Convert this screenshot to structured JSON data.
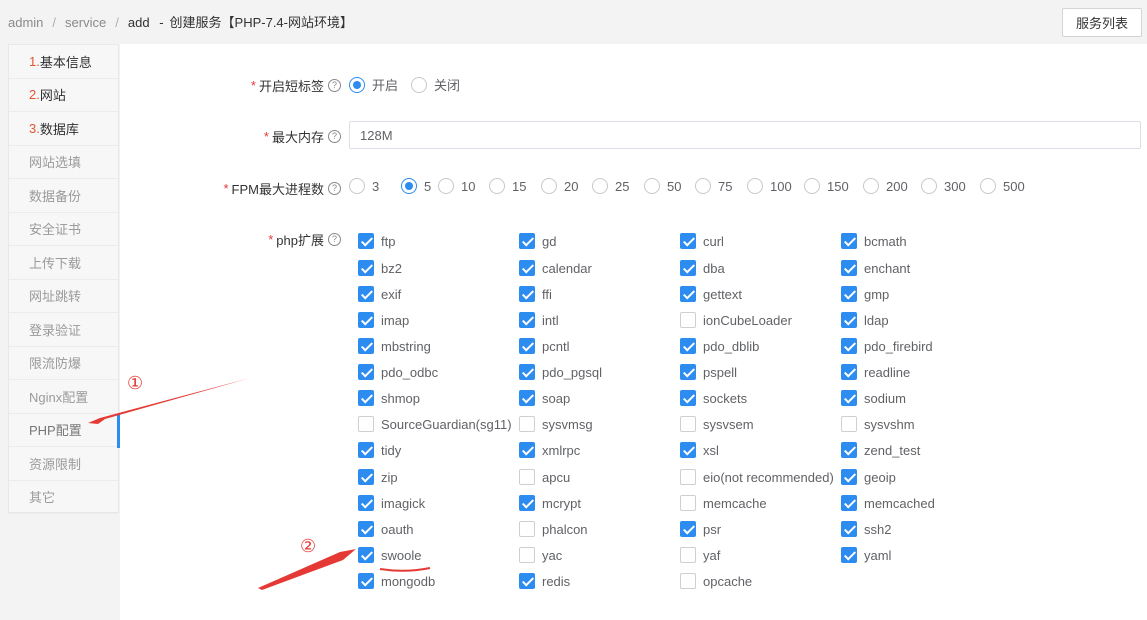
{
  "breadcrumb": {
    "root": "admin",
    "section": "service",
    "current": "add",
    "dash": "-",
    "title": "创建服务【PHP-7.4-网站环境】"
  },
  "header": {
    "list_button": "服务列表"
  },
  "sidebar": {
    "items": [
      {
        "num": "1.",
        "label": "基本信息"
      },
      {
        "num": "2.",
        "label": "网站"
      },
      {
        "num": "3.",
        "label": "数据库"
      },
      {
        "num": "",
        "label": "网站选填"
      },
      {
        "num": "",
        "label": "数据备份"
      },
      {
        "num": "",
        "label": "安全证书"
      },
      {
        "num": "",
        "label": "上传下载"
      },
      {
        "num": "",
        "label": "网址跳转"
      },
      {
        "num": "",
        "label": "登录验证"
      },
      {
        "num": "",
        "label": "限流防爆"
      },
      {
        "num": "",
        "label": "Nginx配置"
      },
      {
        "num": "",
        "label": "PHP配置"
      },
      {
        "num": "",
        "label": "资源限制"
      },
      {
        "num": "",
        "label": "其它"
      }
    ],
    "active": "PHP配置"
  },
  "form": {
    "short_tag": {
      "label": "开启短标签",
      "options": [
        "开启",
        "关闭"
      ],
      "selected": "开启"
    },
    "memory": {
      "label": "最大内存",
      "value": "128M"
    },
    "fpm": {
      "label": "FPM最大进程数",
      "options": [
        "3",
        "5",
        "10",
        "15",
        "20",
        "25",
        "50",
        "75",
        "100",
        "150",
        "200",
        "300",
        "500"
      ],
      "selected": "5"
    },
    "extensions": {
      "label": "php扩展",
      "items": [
        {
          "name": "ftp",
          "checked": true
        },
        {
          "name": "gd",
          "checked": true
        },
        {
          "name": "curl",
          "checked": true
        },
        {
          "name": "bcmath",
          "checked": true
        },
        {
          "name": "bz2",
          "checked": true
        },
        {
          "name": "calendar",
          "checked": true
        },
        {
          "name": "dba",
          "checked": true
        },
        {
          "name": "enchant",
          "checked": true
        },
        {
          "name": "exif",
          "checked": true
        },
        {
          "name": "ffi",
          "checked": true
        },
        {
          "name": "gettext",
          "checked": true
        },
        {
          "name": "gmp",
          "checked": true
        },
        {
          "name": "imap",
          "checked": true
        },
        {
          "name": "intl",
          "checked": true
        },
        {
          "name": "ionCubeLoader",
          "checked": false
        },
        {
          "name": "ldap",
          "checked": true
        },
        {
          "name": "mbstring",
          "checked": true
        },
        {
          "name": "pcntl",
          "checked": true
        },
        {
          "name": "pdo_dblib",
          "checked": true
        },
        {
          "name": "pdo_firebird",
          "checked": true
        },
        {
          "name": "pdo_odbc",
          "checked": true
        },
        {
          "name": "pdo_pgsql",
          "checked": true
        },
        {
          "name": "pspell",
          "checked": true
        },
        {
          "name": "readline",
          "checked": true
        },
        {
          "name": "shmop",
          "checked": true
        },
        {
          "name": "soap",
          "checked": true
        },
        {
          "name": "sockets",
          "checked": true
        },
        {
          "name": "sodium",
          "checked": true
        },
        {
          "name": "SourceGuardian(sg11)",
          "checked": false
        },
        {
          "name": "sysvmsg",
          "checked": false
        },
        {
          "name": "sysvsem",
          "checked": false
        },
        {
          "name": "sysvshm",
          "checked": false
        },
        {
          "name": "tidy",
          "checked": true
        },
        {
          "name": "xmlrpc",
          "checked": true
        },
        {
          "name": "xsl",
          "checked": true
        },
        {
          "name": "zend_test",
          "checked": true
        },
        {
          "name": "zip",
          "checked": true
        },
        {
          "name": "apcu",
          "checked": false
        },
        {
          "name": "eio(not recommended)",
          "checked": false
        },
        {
          "name": "geoip",
          "checked": true
        },
        {
          "name": "imagick",
          "checked": true
        },
        {
          "name": "mcrypt",
          "checked": true
        },
        {
          "name": "memcache",
          "checked": false
        },
        {
          "name": "memcached",
          "checked": true
        },
        {
          "name": "oauth",
          "checked": true
        },
        {
          "name": "phalcon",
          "checked": false
        },
        {
          "name": "psr",
          "checked": true
        },
        {
          "name": "ssh2",
          "checked": true
        },
        {
          "name": "swoole",
          "checked": true
        },
        {
          "name": "yac",
          "checked": false
        },
        {
          "name": "yaf",
          "checked": false
        },
        {
          "name": "yaml",
          "checked": true
        },
        {
          "name": "mongodb",
          "checked": true
        },
        {
          "name": "redis",
          "checked": true
        },
        {
          "name": "opcache",
          "checked": false
        }
      ]
    }
  },
  "annotations": {
    "one": "①",
    "two": "②",
    "color": "#e53935"
  },
  "colors": {
    "accent": "#2d8cf0",
    "required": "#e53935",
    "step_number": "#e4552f"
  },
  "icons": {
    "help": "question-circle-icon"
  }
}
